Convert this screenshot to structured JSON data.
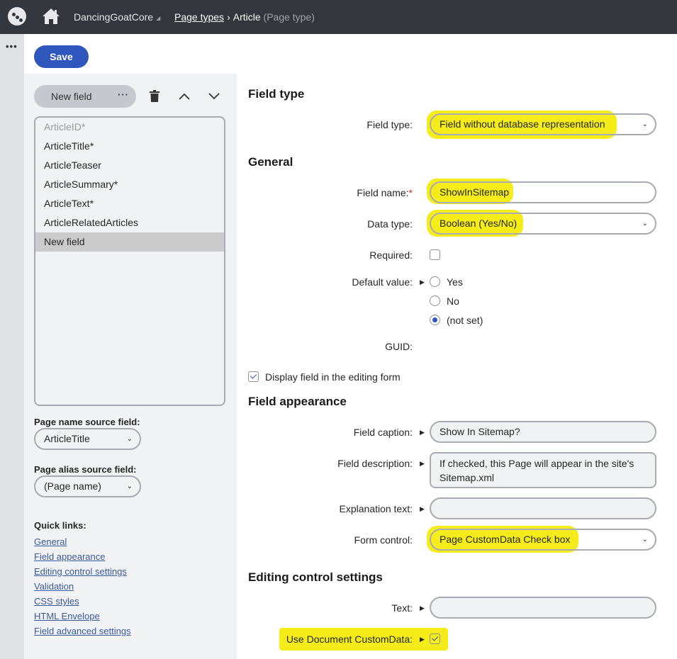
{
  "topbar": {
    "site_name": "DancingGoatCore",
    "breadcrumb": {
      "parent": "Page types",
      "current": "Article",
      "current_type": "(Page type)"
    }
  },
  "strip": {
    "more_label": "..."
  },
  "toolbar": {
    "save_label": "Save"
  },
  "left_panel": {
    "new_field_label": "New field",
    "more_label": "···",
    "fields": [
      {
        "label": "ArticleID*",
        "state": "disabled"
      },
      {
        "label": "ArticleTitle*",
        "state": "normal"
      },
      {
        "label": "ArticleTeaser",
        "state": "normal"
      },
      {
        "label": "ArticleSummary*",
        "state": "normal"
      },
      {
        "label": "ArticleText*",
        "state": "normal"
      },
      {
        "label": "ArticleRelatedArticles",
        "state": "normal"
      },
      {
        "label": "New field",
        "state": "selected"
      }
    ],
    "page_name_source": {
      "label": "Page name source field:",
      "value": "ArticleTitle"
    },
    "page_alias_source": {
      "label": "Page alias source field:",
      "value": "(Page name)"
    },
    "quick_links": {
      "title": "Quick links:",
      "links": [
        "General",
        "Field appearance",
        "Editing control settings",
        "Validation",
        "CSS styles",
        "HTML Envelope",
        "Field advanced settings"
      ]
    }
  },
  "form": {
    "field_type_section": {
      "title": "Field type",
      "field_type": {
        "label": "Field type:",
        "value": "Field without database representation"
      }
    },
    "general_section": {
      "title": "General",
      "field_name": {
        "label": "Field name:",
        "required_mark": "*",
        "value": "ShowInSitemap"
      },
      "data_type": {
        "label": "Data type:",
        "value": "Boolean (Yes/No)"
      },
      "required": {
        "label": "Required:",
        "checked": false
      },
      "default_value": {
        "label": "Default value:",
        "options": [
          "Yes",
          "No",
          "(not set)"
        ],
        "selected": "(not set)"
      },
      "guid": {
        "label": "GUID:",
        "value": ""
      },
      "display_in_form": {
        "label": "Display field in the editing form",
        "checked": true
      }
    },
    "appearance_section": {
      "title": "Field appearance",
      "field_caption": {
        "label": "Field caption:",
        "value": "Show In Sitemap?"
      },
      "field_description": {
        "label": "Field description:",
        "value": "If checked, this Page will appear in the site's Sitemap.xml"
      },
      "explanation_text": {
        "label": "Explanation text:",
        "value": ""
      },
      "form_control": {
        "label": "Form control:",
        "value": "Page CustomData Check box"
      }
    },
    "editing_section": {
      "title": "Editing control settings",
      "text": {
        "label": "Text:",
        "value": ""
      },
      "use_custom_data": {
        "label": "Use Document CustomData:",
        "checked": true
      }
    }
  },
  "colors": {
    "topbar": "#33363d",
    "primary": "#2e56bd",
    "highlight": "#f4ea00",
    "link": "#3a5a9c",
    "panel_bg": "#f1f2f4"
  }
}
